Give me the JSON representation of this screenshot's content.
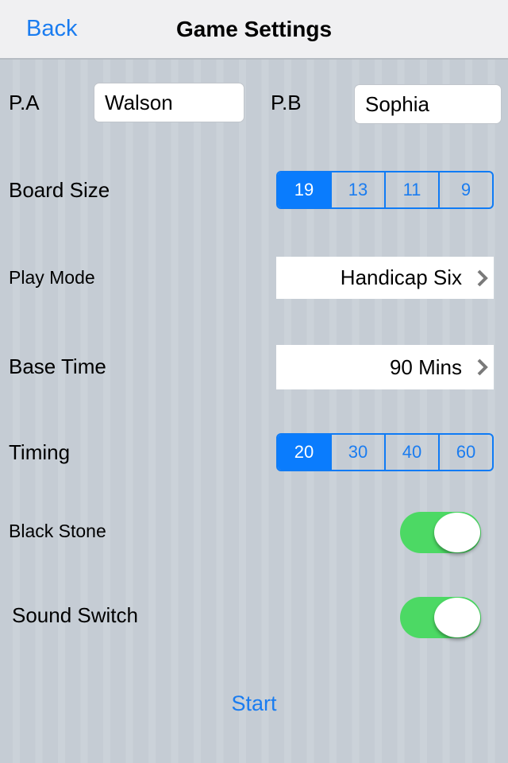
{
  "navbar": {
    "back_label": "Back",
    "title": "Game Settings"
  },
  "players": {
    "a_label": "P.A",
    "a_value": "Walson",
    "b_label": "P.B",
    "b_value": "Sophia"
  },
  "board_size": {
    "label": "Board Size",
    "options": [
      "19",
      "13",
      "11",
      "9"
    ],
    "selected": "19"
  },
  "play_mode": {
    "label": "Play Mode",
    "value": "Handicap Six",
    "icon": "chevron-right-icon"
  },
  "base_time": {
    "label": "Base Time",
    "value": "90 Mins",
    "icon": "chevron-right-icon"
  },
  "timing": {
    "label": "Timing",
    "options": [
      "20",
      "30",
      "40",
      "60"
    ],
    "selected": "20"
  },
  "black_stone": {
    "label": "Black Stone",
    "on": true
  },
  "sound_switch": {
    "label": "Sound Switch",
    "on": true
  },
  "start_label": "Start",
  "colors": {
    "accent": "#1a7cf0",
    "toggle_on": "#4cd964",
    "segment_selected": "#0a7cfd"
  }
}
